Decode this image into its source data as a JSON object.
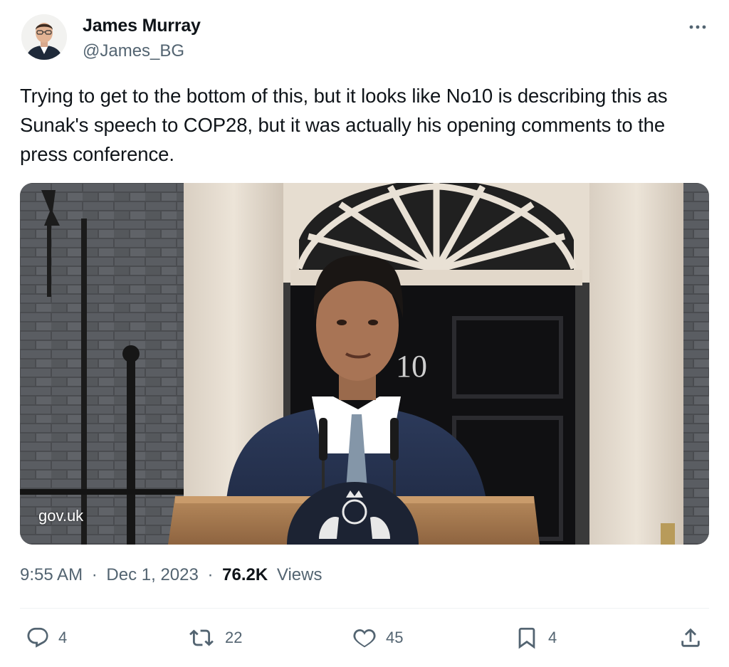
{
  "author": {
    "name": "James Murray",
    "handle": "@James_BG"
  },
  "tweet": {
    "text": "Trying to get to the bottom of this, but it looks like No10 is describing this as Sunak's speech to COP28, but it was actually his opening comments to the press conference."
  },
  "media": {
    "credit": "gov.uk",
    "door_number": "10"
  },
  "meta": {
    "time": "9:55 AM",
    "separator": "·",
    "date": "Dec 1, 2023",
    "views_count": "76.2K",
    "views_label": "Views"
  },
  "actions": {
    "replies": "4",
    "reposts": "22",
    "likes": "45",
    "bookmarks": "4"
  },
  "colors": {
    "text_primary": "#0f1419",
    "text_secondary": "#536471",
    "divider": "#eff3f4"
  },
  "icons": {
    "more": "more-dots-icon",
    "reply": "reply-bubble-icon",
    "repost": "repost-arrows-icon",
    "like": "heart-icon",
    "bookmark": "bookmark-icon",
    "share": "share-upload-icon"
  }
}
